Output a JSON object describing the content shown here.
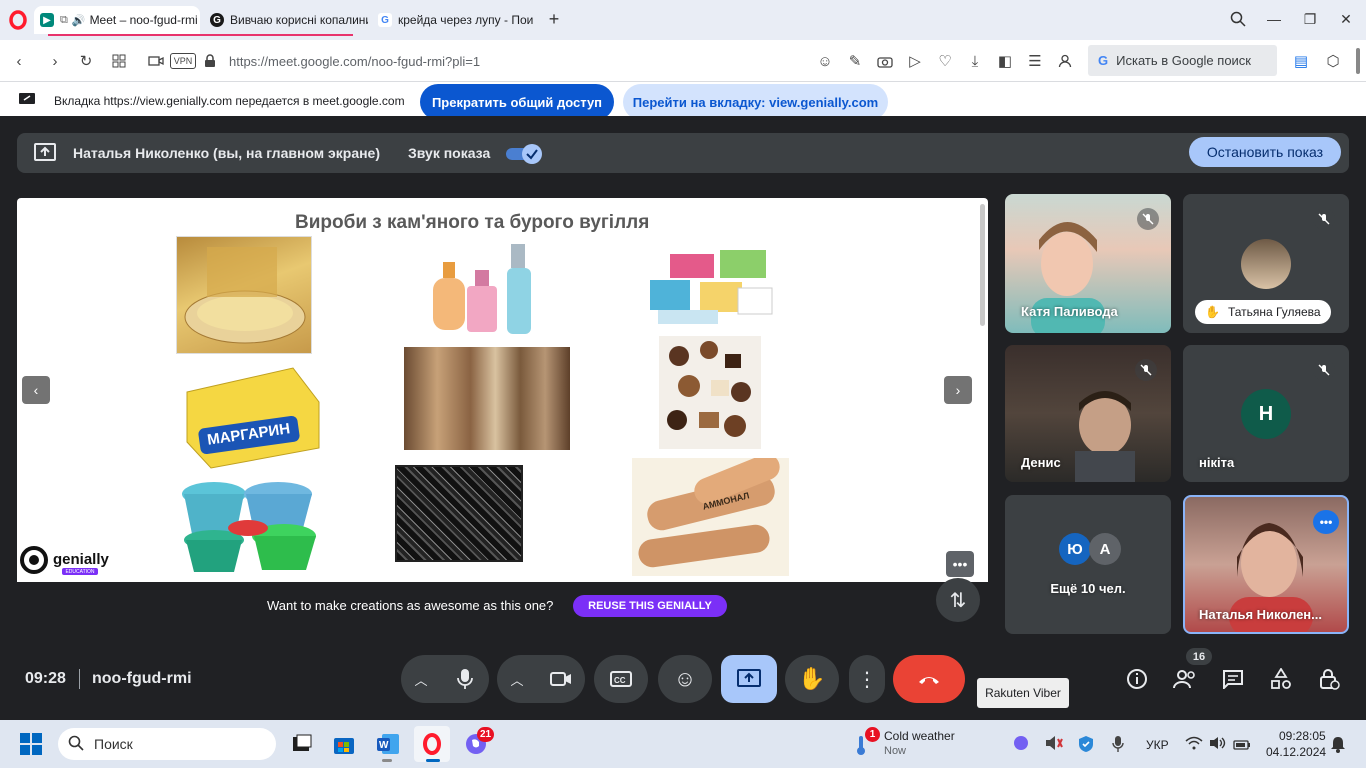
{
  "browser": {
    "tabs": [
      {
        "label": "Meet – noo-fgud-rmi",
        "active": true
      },
      {
        "label": "Вивчаю корисні копалини",
        "active": false
      },
      {
        "label": "крейда через лупу - Пои",
        "active": false
      }
    ],
    "vpn_label": "VPN",
    "url": "https://meet.google.com/noo-fgud-rmi?pli=1",
    "search_placeholder": "Искать в Google поиск"
  },
  "infobar": {
    "message": "Вкладка https://view.genially.com передается в meet.google.com",
    "stop_sharing_label": "Прекратить общий доступ",
    "goto_tab_label": "Перейти на вкладку: view.genially.com"
  },
  "present_bar": {
    "presenter_label": "Наталья Николенко (вы, на главном экране)",
    "audio_label": "Звук показа",
    "stop_present_label": "Остановить показ"
  },
  "slide": {
    "title": "Вироби з кам'яного та бурого вугілля",
    "margarine_label": "МАРГАРИН",
    "brand_label": "genially",
    "brand_sub": "EDUCATION",
    "reuse_text": "Want to make creations as awesome as this one?",
    "reuse_button": "REUSE THIS GENIALLY",
    "ammonal_label": "АММОНАЛ"
  },
  "participants": [
    {
      "name": "Катя Паливода"
    },
    {
      "name": "Татьяна Гуляева"
    },
    {
      "name": "Денис"
    },
    {
      "name": "нікіта",
      "initial": "Н"
    },
    {
      "name": "Ещё 10 чел.",
      "initials": [
        "Ю",
        "А"
      ]
    },
    {
      "name": "Наталья Николен..."
    }
  ],
  "meeting": {
    "time": "09:28",
    "code": "noo-fgud-rmi",
    "participant_count": "16",
    "tooltip": "Rakuten Viber"
  },
  "taskbar": {
    "search_label": "Поиск",
    "viber_badge": "21",
    "weather_badge": "1",
    "weather_title": "Cold weather",
    "weather_sub": "Now",
    "lang": "УКР",
    "time": "09:28:05",
    "date": "04.12.2024"
  },
  "colors": {
    "meet_bg": "#202124",
    "accent_blue": "#0b57d0",
    "end_call_red": "#ea4335",
    "present_blue": "#a8c7fa",
    "genially_purple": "#7b2ff7"
  }
}
